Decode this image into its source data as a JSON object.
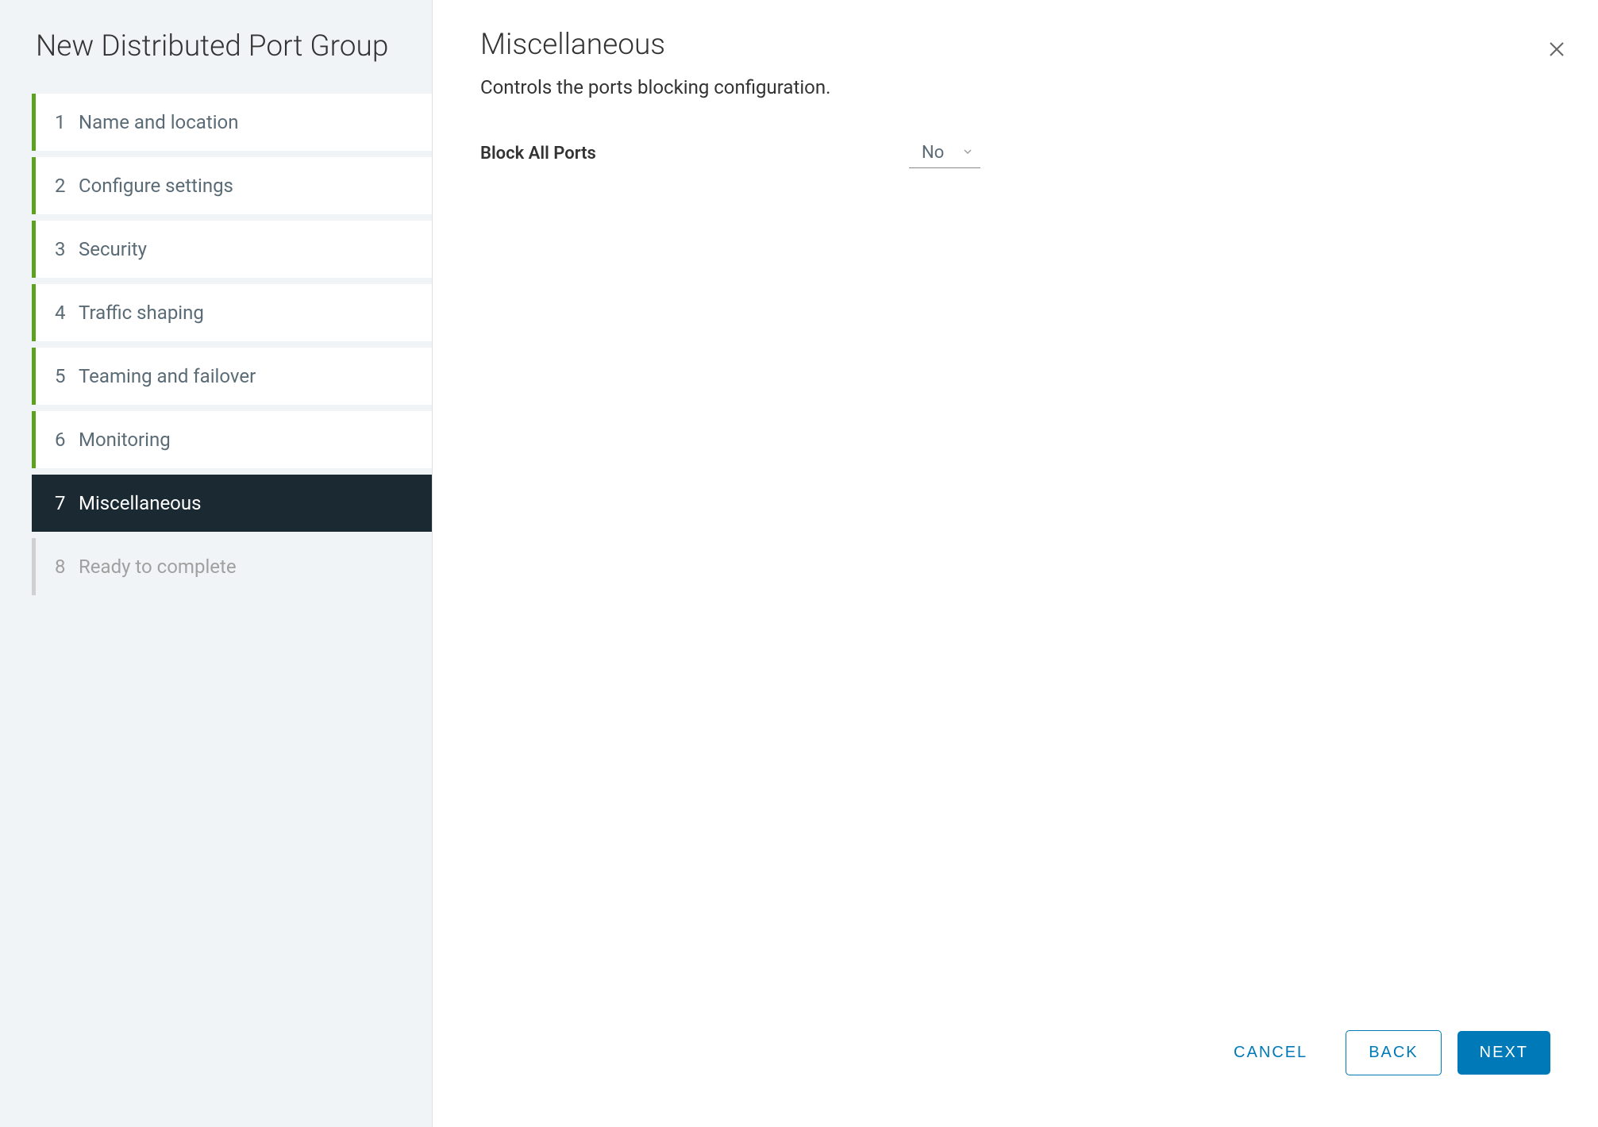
{
  "sidebar": {
    "title": "New Distributed Port Group",
    "steps": [
      {
        "number": "1",
        "label": "Name and location",
        "state": "completed"
      },
      {
        "number": "2",
        "label": "Configure settings",
        "state": "completed"
      },
      {
        "number": "3",
        "label": "Security",
        "state": "completed"
      },
      {
        "number": "4",
        "label": "Traffic shaping",
        "state": "completed"
      },
      {
        "number": "5",
        "label": "Teaming and failover",
        "state": "completed"
      },
      {
        "number": "6",
        "label": "Monitoring",
        "state": "completed"
      },
      {
        "number": "7",
        "label": "Miscellaneous",
        "state": "active"
      },
      {
        "number": "8",
        "label": "Ready to complete",
        "state": "disabled"
      }
    ]
  },
  "main": {
    "title": "Miscellaneous",
    "subtitle": "Controls the ports blocking configuration.",
    "form": {
      "block_all_ports_label": "Block All Ports",
      "block_all_ports_value": "No"
    }
  },
  "footer": {
    "cancel_label": "CANCEL",
    "back_label": "BACK",
    "next_label": "NEXT"
  }
}
